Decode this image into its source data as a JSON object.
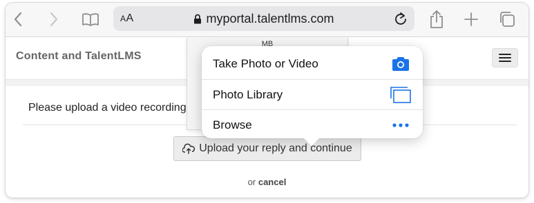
{
  "browser": {
    "text_size_label": "AA",
    "url": "myportal.talentlms.com"
  },
  "page": {
    "brand": "Content and TalentLMS",
    "prompt": "Please upload a video recording",
    "upload_button": "Upload your reply and continue",
    "or_text": "or",
    "cancel_text": "cancel"
  },
  "file_picker": {
    "unit_label": "MB"
  },
  "popover": {
    "items": [
      {
        "label": "Take Photo or Video",
        "icon": "camera-icon"
      },
      {
        "label": "Photo Library",
        "icon": "photo-library-icon"
      },
      {
        "label": "Browse",
        "icon": "more-dots-icon"
      }
    ]
  },
  "colors": {
    "accent": "#1a73e8",
    "toolbar_bg": "#f7f7f7",
    "url_bar_bg": "#e6e6e8"
  }
}
